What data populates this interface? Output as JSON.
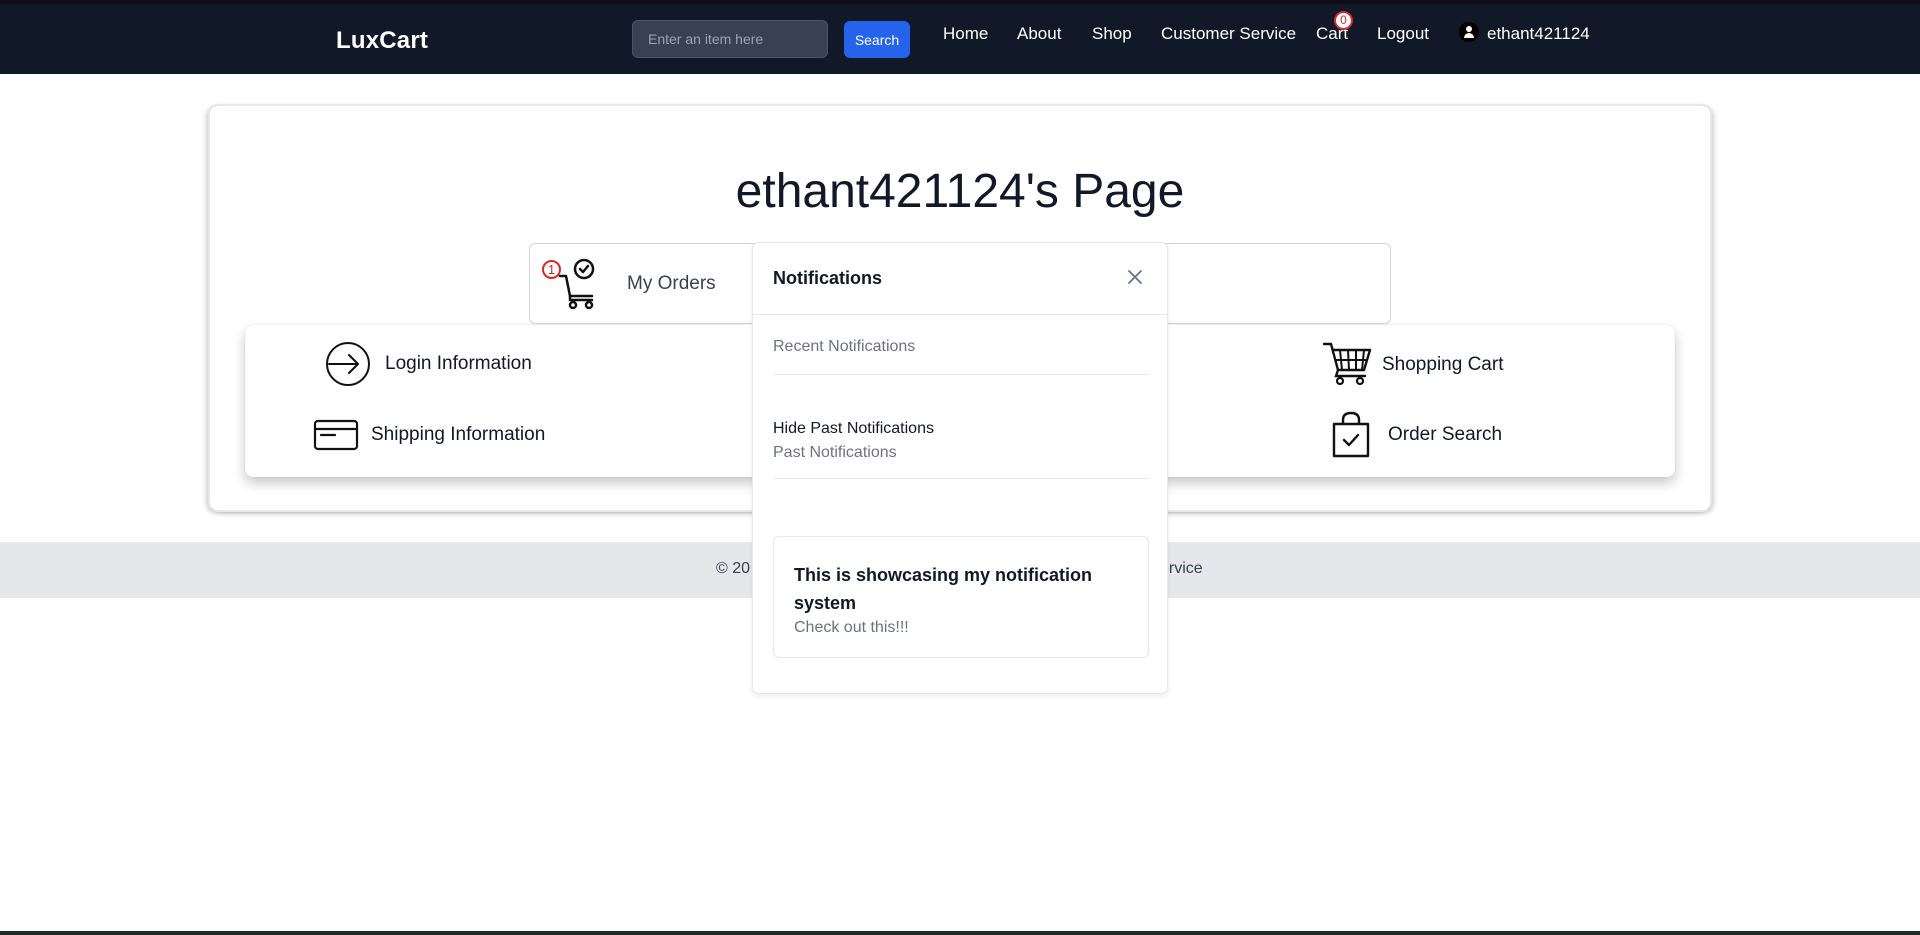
{
  "navbar": {
    "brand": "LuxCart",
    "search_placeholder": "Enter an item here",
    "search_button": "Search",
    "links": {
      "home": "Home",
      "about": "About",
      "shop": "Shop",
      "customer_service": "Customer Service",
      "cart": "Cart",
      "logout": "Logout"
    },
    "cart_count": "0",
    "username": "ethant421124"
  },
  "page": {
    "title": "ethant421124's Page",
    "orders": {
      "label": "My Orders",
      "badge": "1"
    },
    "links": {
      "login_info": "Login Information",
      "shipping_info": "Shipping Information",
      "shopping_cart": "Shopping Cart",
      "order_search": "Order Search"
    }
  },
  "footer": {
    "left_visible": "© 20",
    "right_visible": "ervice"
  },
  "notifications": {
    "title": "Notifications",
    "recent_label": "Recent Notifications",
    "hide_past_label": "Hide Past Notifications",
    "past_label": "Past Notifications",
    "items": [
      {
        "title": "This is showcasing my notification system",
        "body": "Check out this!!!"
      }
    ]
  },
  "icons": {
    "orders": "cart-check-icon",
    "login": "arrow-in-circle-icon",
    "shipping": "credit-card-icon",
    "cart": "shopping-cart-icon",
    "order_search": "shopping-bag-check-icon",
    "user": "user-icon",
    "close": "close-icon"
  },
  "colors": {
    "navbar_bg": "#111827",
    "search_button": "#2563eb",
    "badge": "#dc2626",
    "footer_bg": "#e5e7eb"
  }
}
